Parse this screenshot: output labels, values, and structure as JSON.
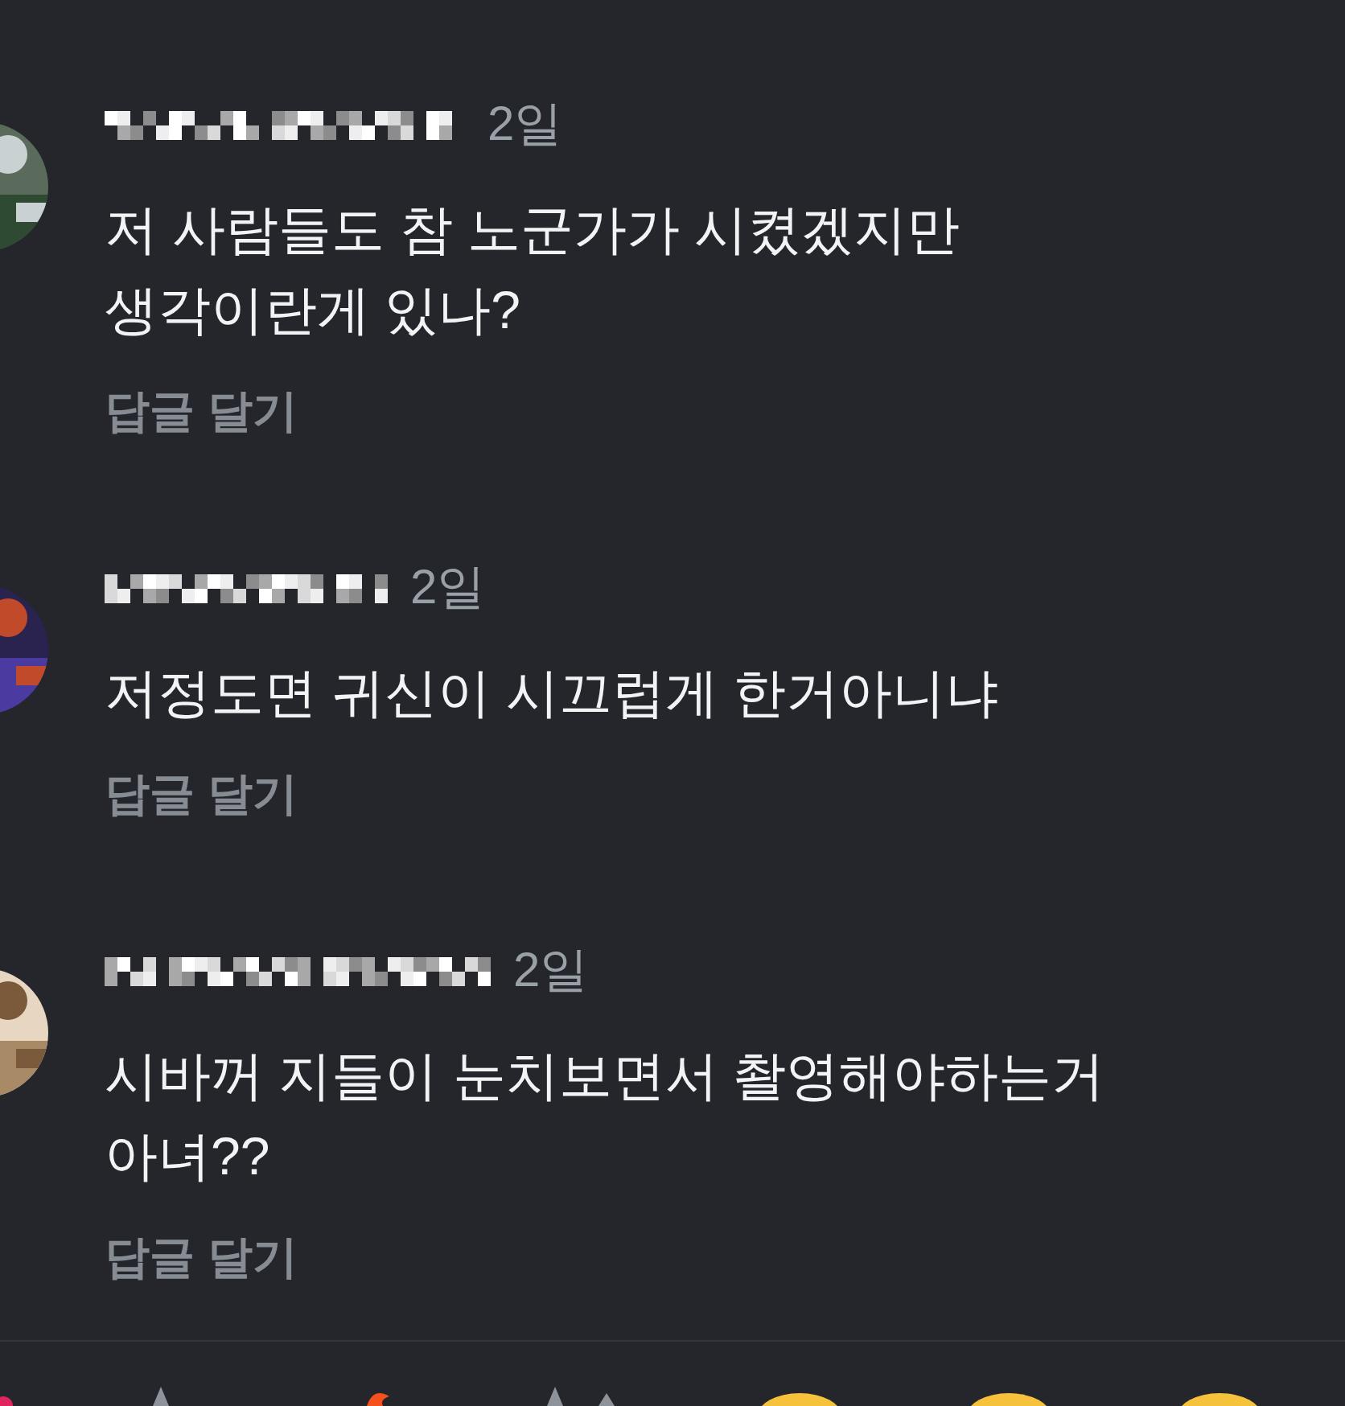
{
  "comments": [
    {
      "time": "2일",
      "lines": [
        "저 사람들도 참 노군가가 시켰겠지만",
        "생각이란게 있나?"
      ],
      "reply_label": "답글 달기"
    },
    {
      "time": "2일",
      "lines": [
        "저정도면 귀신이 시끄럽게 한거아니냐"
      ],
      "reply_label": "답글 달기"
    },
    {
      "time": "2일",
      "lines": [
        "시바꺼 지들이 눈치보면서 촬영해야하는거",
        "아녀??"
      ],
      "reply_label": "답글 달기"
    }
  ]
}
